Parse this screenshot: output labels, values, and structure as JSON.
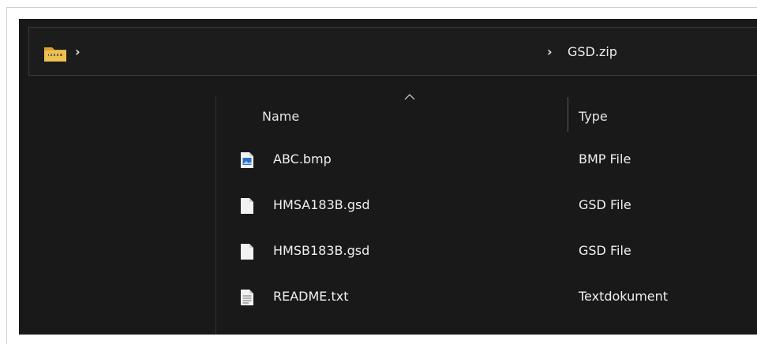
{
  "address_bar": {
    "location": "GSD.zip",
    "icons": [
      "zip-folder-icon",
      "chevron-right-icon"
    ]
  },
  "columns": {
    "name_label": "Name",
    "type_label": "Type",
    "sort_indicator": "sort-ascending-icon"
  },
  "files": [
    {
      "name": "ABC.bmp",
      "type": "BMP File",
      "icon": "image-file-icon"
    },
    {
      "name": "HMSA183B.gsd",
      "type": "GSD File",
      "icon": "generic-file-icon"
    },
    {
      "name": "HMSB183B.gsd",
      "type": "GSD File",
      "icon": "generic-file-icon"
    },
    {
      "name": "README.txt",
      "type": "Textdokument",
      "icon": "text-file-icon"
    }
  ],
  "colors": {
    "background": "#191919",
    "text": "#f0f0f0",
    "folder_yellow": "#e8b64a",
    "image_icon_blue": "#2f6fc7"
  }
}
